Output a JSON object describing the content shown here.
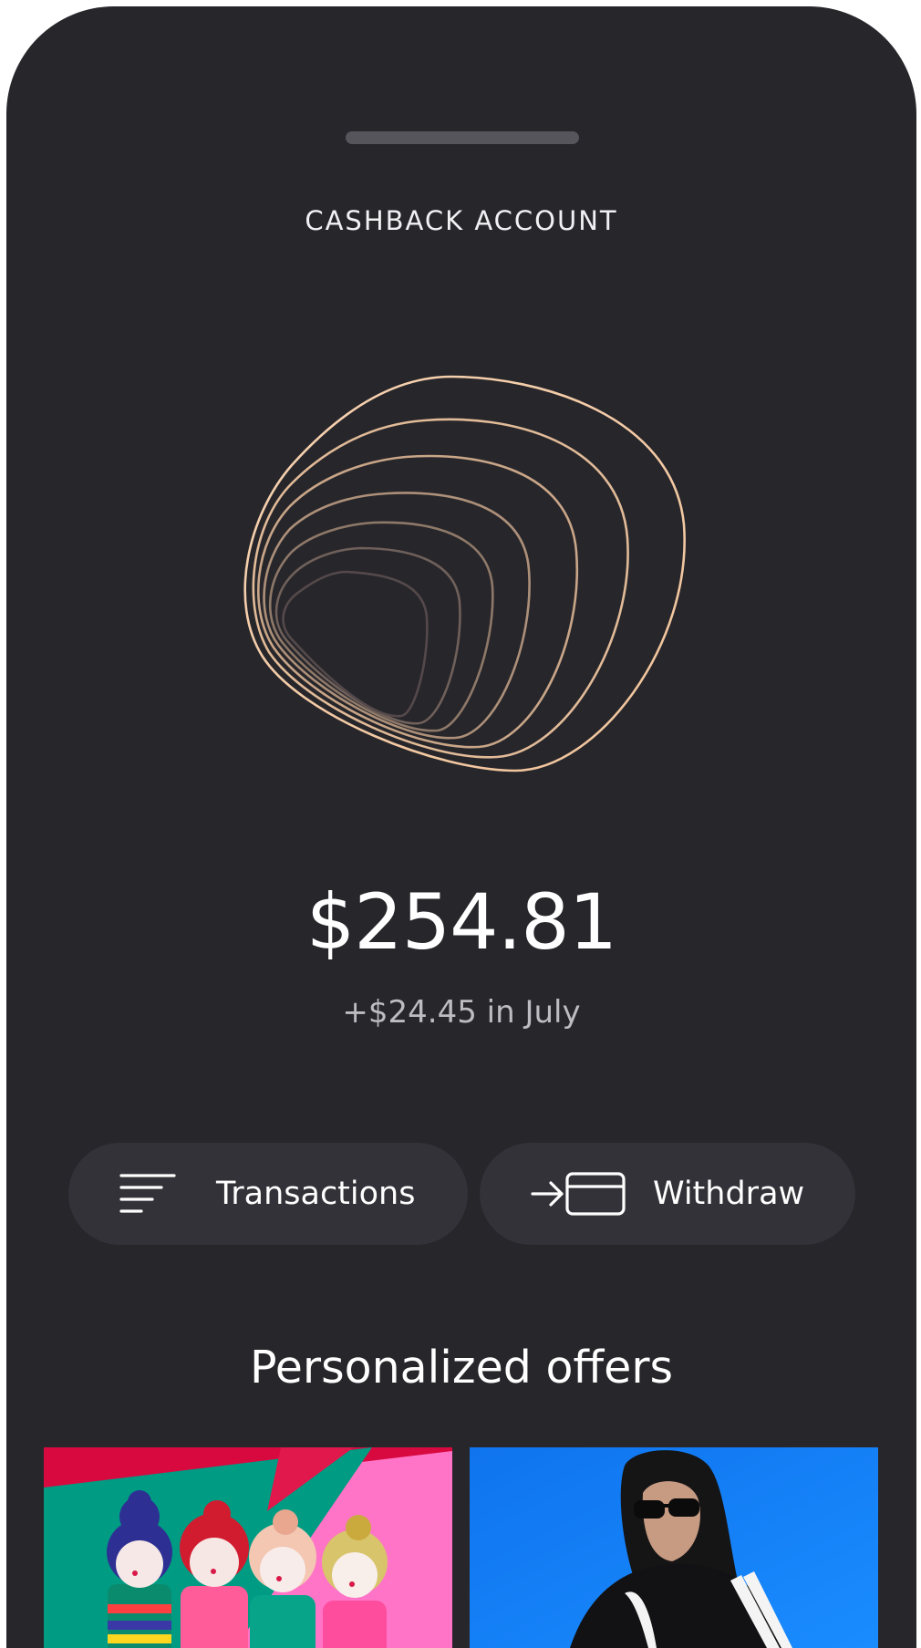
{
  "header": {
    "title": "CASHBACK ACCOUNT"
  },
  "balance": {
    "amount": "$254.81",
    "delta": "+$24.45 in July"
  },
  "actions": {
    "transactions_label": "Transactions",
    "withdraw_label": "Withdraw"
  },
  "offers": {
    "section_title": "Personalized offers",
    "items": [
      {
        "icon": "perfume-dolls-image"
      },
      {
        "icon": "tracksuit-model-image"
      }
    ]
  },
  "colors": {
    "background": "#27262b",
    "button": "#333238",
    "accent_gold": "#f2c7a2"
  }
}
